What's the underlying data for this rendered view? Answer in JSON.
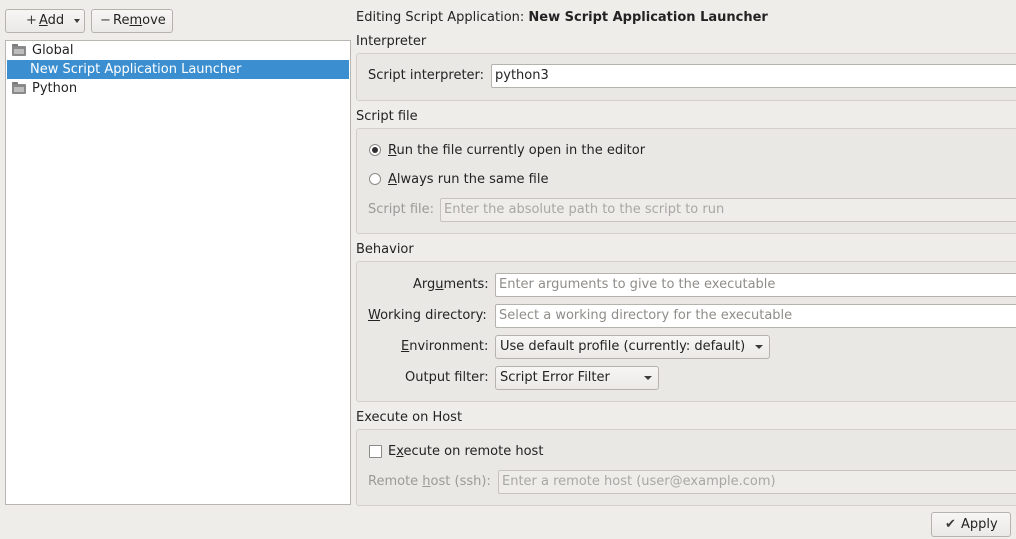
{
  "toolbar": {
    "add_label_prefix": "",
    "add_mnemonic": "A",
    "add_rest": "dd",
    "remove_prefix": "Re",
    "remove_mnemonic": "m",
    "remove_rest": "ove"
  },
  "tree": {
    "items": [
      {
        "label": "Global",
        "icon": "folder-icon",
        "selected": false
      },
      {
        "label": "New Script Application Launcher",
        "icon": "",
        "selected": true
      },
      {
        "label": "Python",
        "icon": "folder-icon",
        "selected": false
      }
    ]
  },
  "editor": {
    "title_prefix": "Editing Script Application: ",
    "title_name": "New Script Application Launcher"
  },
  "interpreter": {
    "heading": "Interpreter",
    "label": "Script interpreter:",
    "value": "python3"
  },
  "script_file": {
    "heading": "Script file",
    "radio_current_mnemonic": "R",
    "radio_current_rest": "un the file currently open in the editor",
    "radio_same_mnemonic": "A",
    "radio_same_rest": "lways run the same file",
    "label": "Script file:",
    "placeholder": "Enter the absolute path to the script to run"
  },
  "behavior": {
    "heading": "Behavior",
    "arguments_prefix": "Arg",
    "arguments_mnemonic": "u",
    "arguments_rest": "ments:",
    "arguments_placeholder": "Enter arguments to give to the executable",
    "workdir_mnemonic": "W",
    "workdir_rest": "orking directory:",
    "workdir_placeholder": "Select a working directory for the executable",
    "env_mnemonic": "E",
    "env_rest": "nvironment:",
    "env_value": "Use default profile (currently: default)",
    "output_label": "Output filter:",
    "output_value": "Script Error Filter"
  },
  "host": {
    "heading": "Execute on Host",
    "remote_prefix": "E",
    "remote_mnemonic": "x",
    "remote_rest": "ecute on remote host",
    "remote_checked": false,
    "remote_host_prefix": "Remote ",
    "remote_host_mnemonic": "h",
    "remote_host_rest": "ost (ssh):",
    "remote_host_placeholder": "Enter a remote host (user@example.com)"
  },
  "footer": {
    "apply_label": "Apply"
  }
}
